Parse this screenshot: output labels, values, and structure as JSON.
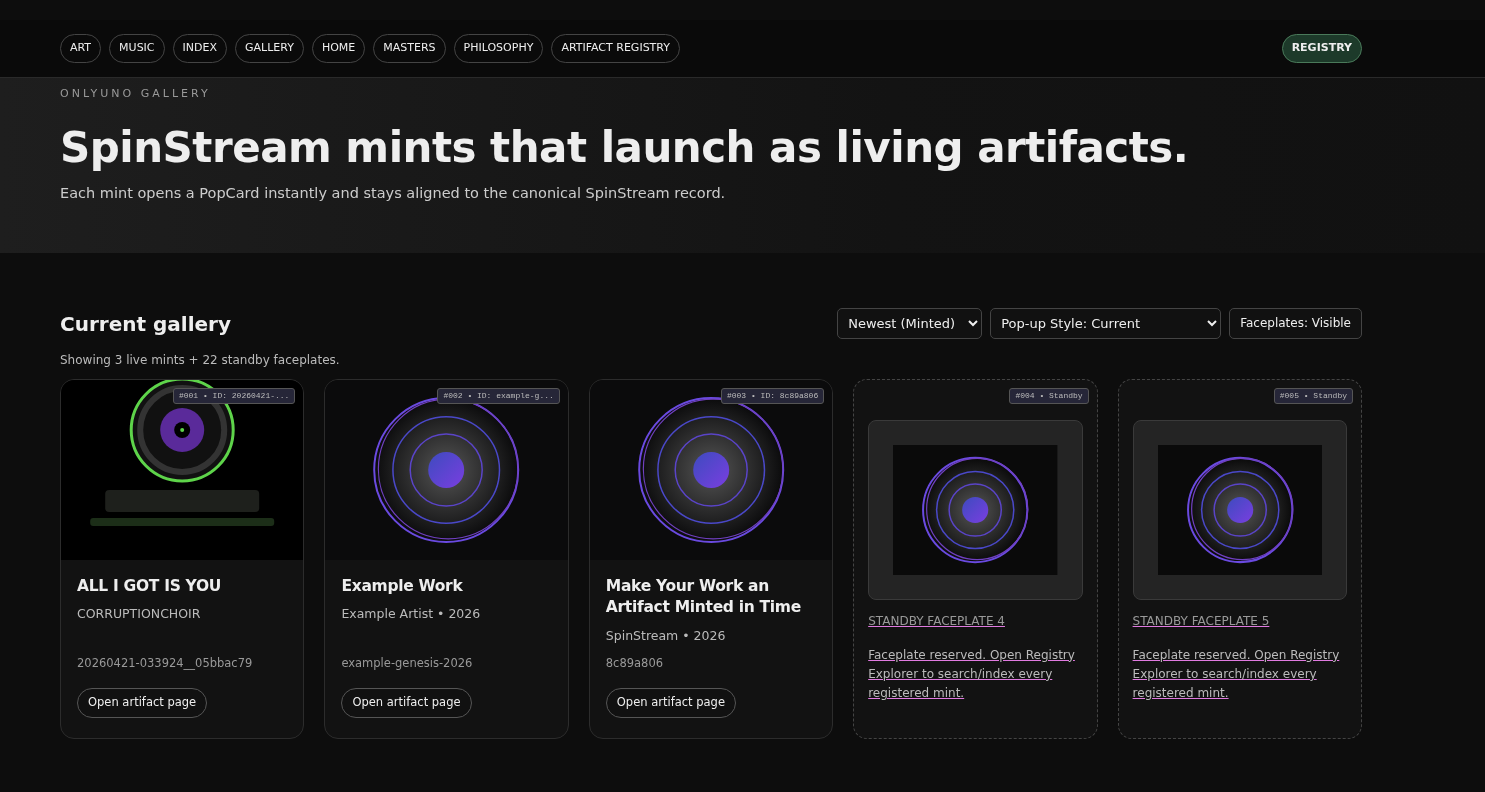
{
  "nav": {
    "links": [
      {
        "label": "ART"
      },
      {
        "label": "MUSIC"
      },
      {
        "label": "INDEX"
      },
      {
        "label": "GALLERY"
      },
      {
        "label": "HOME"
      },
      {
        "label": "MASTERS"
      },
      {
        "label": "PHILOSOPHY"
      },
      {
        "label": "ARTIFACT REGISTRY"
      }
    ],
    "registry_button": "REGISTRY"
  },
  "hero": {
    "eyebrow": "ONLYUNO GALLERY",
    "title": "SpinStream mints that launch as living artifacts.",
    "subtitle": "Each mint opens a PopCard instantly and stays aligned to the canonical SpinStream record."
  },
  "gallery": {
    "title": "Current gallery",
    "sort": "Newest (Minted)",
    "popup_style": "Pop-up Style: Current",
    "faceplates_button": "Faceplates: Visible",
    "summary": "Showing 3 live mints + 22 standby faceplates.",
    "cards": [
      {
        "kind": "mint",
        "badge": "#001 • ID: 20260421-...",
        "title": "ALL I GOT IS YOU",
        "meta": "CORRUPTIONCHOIR",
        "id": "20260421-033924__05bbac79",
        "button": "Open artifact page"
      },
      {
        "kind": "mint",
        "badge": "#002 • ID: example-g...",
        "title": "Example Work",
        "meta": "Example Artist • 2026",
        "id": "example-genesis-2026",
        "button": "Open artifact page"
      },
      {
        "kind": "mint",
        "badge": "#003 • ID: 8c89a806",
        "title": "Make Your Work an Artifact Minted in Time",
        "meta": "SpinStream • 2026",
        "id": "8c89a806",
        "button": "Open artifact page"
      },
      {
        "kind": "standby",
        "badge": "#004 • Standby",
        "title": "STANDBY FACEPLATE 4",
        "text": "Faceplate reserved. Open Registry Explorer to search/index every registered mint."
      },
      {
        "kind": "standby",
        "badge": "#005 • Standby",
        "title": "STANDBY FACEPLATE 5",
        "text": "Faceplate reserved. Open Registry Explorer to search/index every registered mint."
      }
    ]
  }
}
